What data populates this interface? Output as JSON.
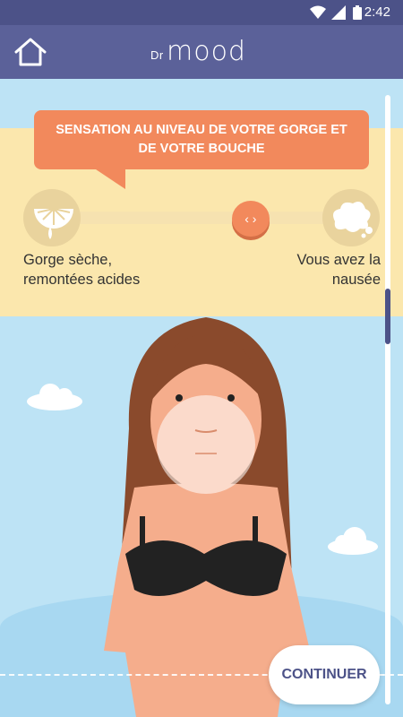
{
  "status": {
    "time": "2:42"
  },
  "header": {
    "logo_prefix": "Dr",
    "logo_word": "mood"
  },
  "prompt": {
    "text": "SENSATION AU NIVEAU DE VOTRE GORGE ET DE VOTRE BOUCHE"
  },
  "slider": {
    "left_label": "Gorge sèche,\nremontées acides",
    "right_label": "Vous avez la\nnausée",
    "left_icon": "lemon-icon",
    "right_icon": "nausea-splat-icon",
    "value": 0.66,
    "thumb_arrows": "‹ ›"
  },
  "actions": {
    "continue_label": "CONTINUER"
  },
  "colors": {
    "header": "#5b6199",
    "statusbar": "#4c5288",
    "accent": "#f2895c",
    "band": "#fbe7ad",
    "sky": "#bde3f5"
  }
}
